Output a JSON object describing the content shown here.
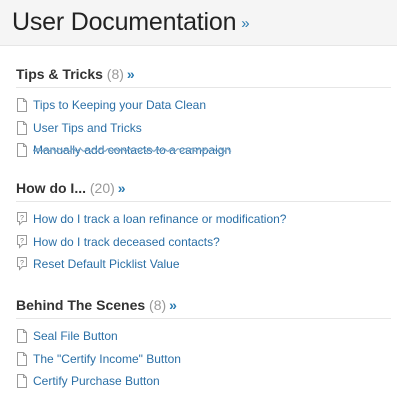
{
  "header": {
    "title": "User Documentation",
    "more": "»"
  },
  "sections": [
    {
      "title": "Tips & Tricks",
      "count": "(8)",
      "more": "»",
      "items": [
        {
          "label": "Tips to Keeping your Data Clean",
          "icon": "document-icon"
        },
        {
          "label": "User Tips and Tricks",
          "icon": "document-icon"
        },
        {
          "label": "Manually add contacts to a campaign",
          "icon": "document-icon"
        }
      ]
    },
    {
      "title": "How do I...",
      "count": "(20)",
      "more": "»",
      "items": [
        {
          "label": "How do I track a loan refinance or modification?",
          "icon": "question-icon"
        },
        {
          "label": "How do I track deceased contacts?",
          "icon": "question-icon"
        },
        {
          "label": "Reset Default Picklist Value",
          "icon": "question-icon"
        }
      ]
    },
    {
      "title": "Behind The Scenes",
      "count": "(8)",
      "more": "»",
      "items": [
        {
          "label": "Seal File Button",
          "icon": "document-icon"
        },
        {
          "label": "The \"Certify Income\" Button",
          "icon": "document-icon"
        },
        {
          "label": "Certify Purchase Button",
          "icon": "document-icon"
        }
      ]
    }
  ],
  "colors": {
    "link": "#2a6fa6",
    "accent": "#2a7ab0",
    "muted": "#999999"
  }
}
